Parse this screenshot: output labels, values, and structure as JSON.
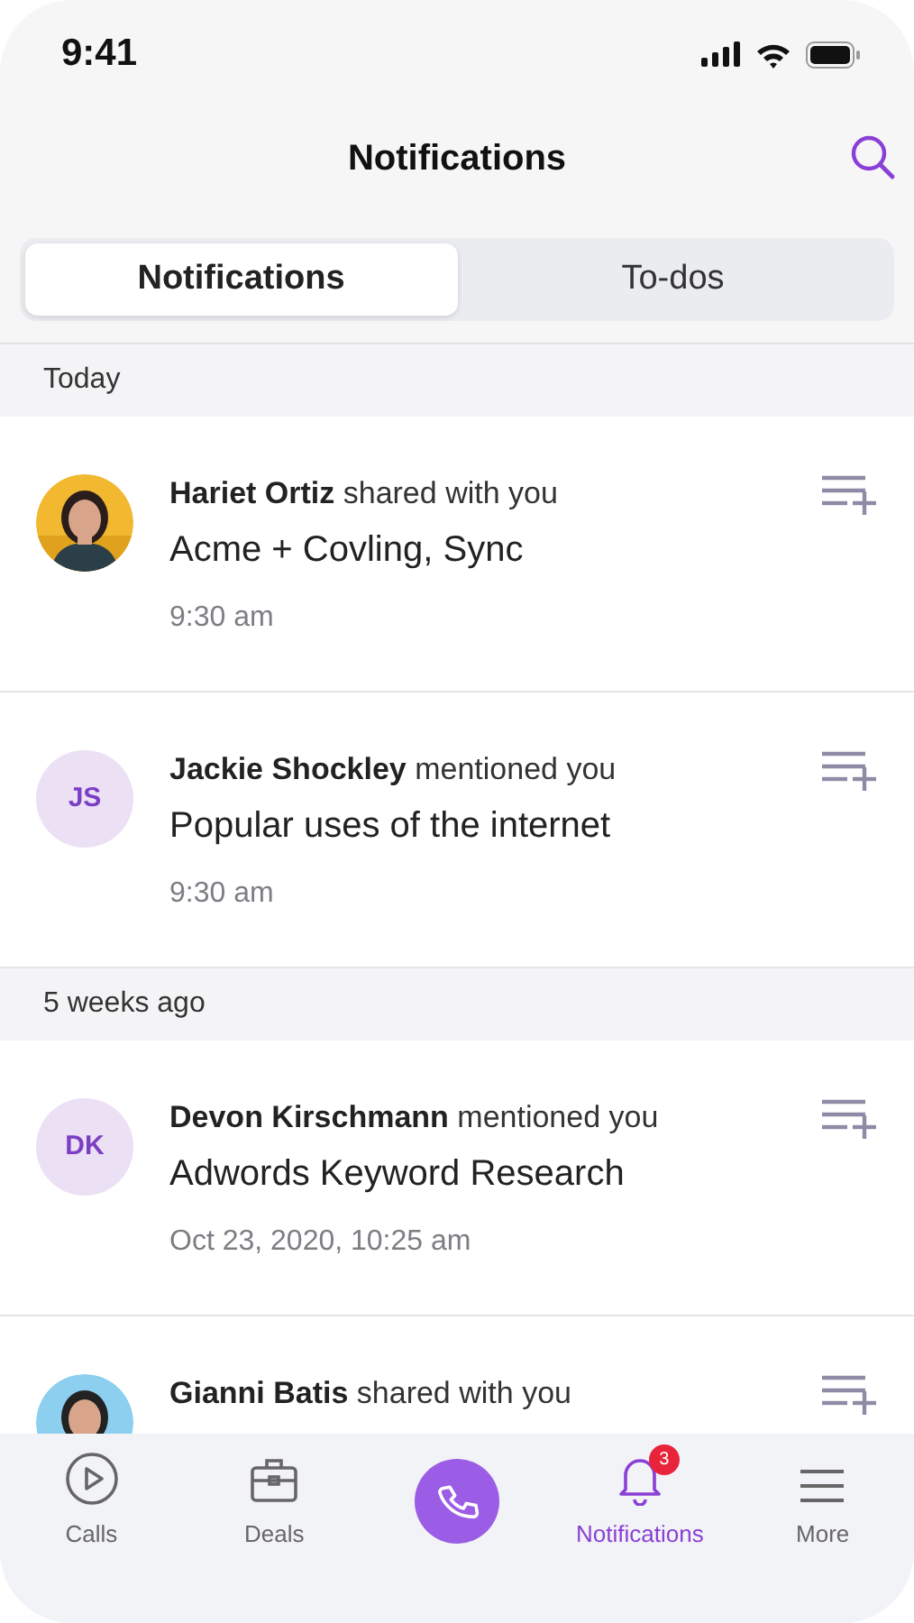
{
  "status_bar": {
    "time": "9:41"
  },
  "header": {
    "title": "Notifications"
  },
  "tabs": [
    {
      "label": "Notifications",
      "selected": true
    },
    {
      "label": "To-dos",
      "selected": false
    }
  ],
  "sections": [
    {
      "heading": "Today",
      "items": [
        {
          "sender": "Hariet Ortiz",
          "action": "shared with you",
          "title": "Acme + Covling, Sync",
          "time": "9:30 am"
        },
        {
          "avatar": {
            "kind": "initials",
            "text": "JS"
          },
          "sender": "Jackie Shockley",
          "action": "mentioned you",
          "title": "Popular uses of the internet",
          "time": "9:30 am"
        }
      ]
    },
    {
      "heading": "5 weeks ago",
      "items": [
        {
          "avatar": {
            "kind": "initials",
            "text": "DK"
          },
          "sender": "Devon Kirschmann",
          "action": "mentioned you",
          "title": "Adwords Keyword Research",
          "time": "Oct 23, 2020, 10:25 am"
        },
        {
          "sender": "Gianni Batis",
          "action": "shared with you"
        }
      ]
    }
  ],
  "tab_bar": [
    {
      "kind": "calls",
      "label": "Calls",
      "selected": false
    },
    {
      "kind": "deals",
      "label": "Deals",
      "selected": false
    },
    {
      "kind": "call-button"
    },
    {
      "kind": "notifications",
      "label": "Notifications",
      "selected": true,
      "badge": "3"
    },
    {
      "kind": "more",
      "label": "More",
      "selected": false
    }
  ]
}
